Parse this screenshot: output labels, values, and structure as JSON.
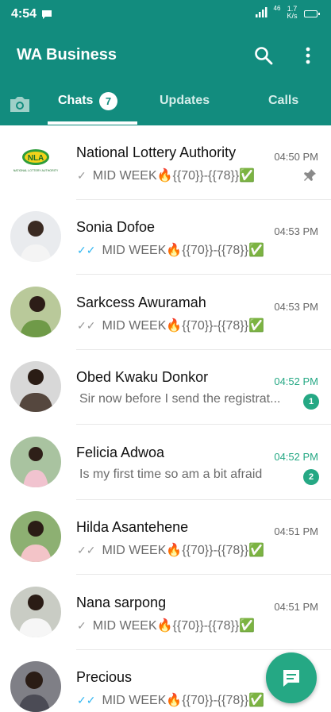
{
  "status_bar": {
    "time": "4:54",
    "network": "46",
    "speed_value": "1.7",
    "speed_unit": "K/s"
  },
  "app": {
    "title": "WA Business"
  },
  "tabs": [
    {
      "label": "Chats",
      "badge": "7"
    },
    {
      "label": "Updates"
    },
    {
      "label": "Calls"
    }
  ],
  "chats": [
    {
      "name": "National Lottery Authority",
      "time": "04:50 PM",
      "preview": "MID WEEK🔥{{70}}-{{78}}✅",
      "ticks": "single",
      "pinned": true,
      "logo_text": "NLA",
      "logo_caption": "NATIONAL LOTTERY AUTHORITY"
    },
    {
      "name": "Sonia Dofoe",
      "time": "04:53 PM",
      "preview": "MID WEEK🔥{{70}}-{{78}}✅",
      "ticks": "double-blue"
    },
    {
      "name": "Sarkcess Awuramah",
      "time": "04:53 PM",
      "preview": "MID WEEK🔥{{70}}-{{78}}✅",
      "ticks": "double-grey"
    },
    {
      "name": "Obed Kwaku Donkor",
      "time": "04:52 PM",
      "preview": "Sir now before I send the registrat...",
      "unread": "1"
    },
    {
      "name": "Felicia Adwoa",
      "time": "04:52 PM",
      "preview": "Is my first time so am a bit afraid",
      "unread": "2"
    },
    {
      "name": "Hilda Asantehene",
      "time": "04:51 PM",
      "preview": "MID WEEK🔥{{70}}-{{78}}✅",
      "ticks": "double-grey"
    },
    {
      "name": "Nana sarpong",
      "time": "04:51 PM",
      "preview": "MID WEEK🔥{{70}}-{{78}}✅",
      "ticks": "single"
    },
    {
      "name": "Precious",
      "time": "",
      "preview": "MID WEEK🔥{{70}}-{{78}}✅",
      "ticks": "double-blue"
    }
  ],
  "colors": {
    "header": "#128C7E",
    "accent": "#25A884",
    "read_tick": "#34B7F1"
  }
}
